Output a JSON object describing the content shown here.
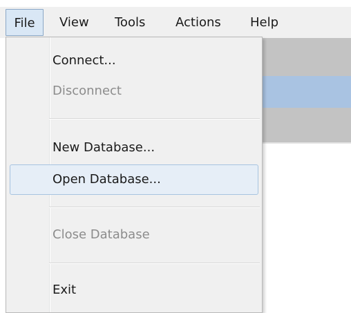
{
  "menubar": {
    "items": [
      {
        "label": "File",
        "active": true
      },
      {
        "label": "View"
      },
      {
        "label": "Tools"
      },
      {
        "label": "Actions"
      },
      {
        "label": "Help"
      }
    ]
  },
  "file_menu": {
    "items": [
      {
        "label": "Connect...",
        "enabled": true
      },
      {
        "label": "Disconnect",
        "enabled": false
      },
      {
        "label": "New Database...",
        "enabled": true
      },
      {
        "label": "Open Database...",
        "enabled": true,
        "highlighted": true
      },
      {
        "label": "Close Database",
        "enabled": false
      },
      {
        "label": "Exit",
        "enabled": true
      }
    ]
  },
  "colors": {
    "menubar_bg": "#f0f0f0",
    "menu_bg": "#f0f0f0",
    "highlight_bg": "#e6eef7",
    "highlight_border": "#a6c3e0",
    "disabled_text": "#8c8c8c",
    "selection_blue": "#a9c3e2",
    "panel_gray": "#c3c3c3"
  }
}
